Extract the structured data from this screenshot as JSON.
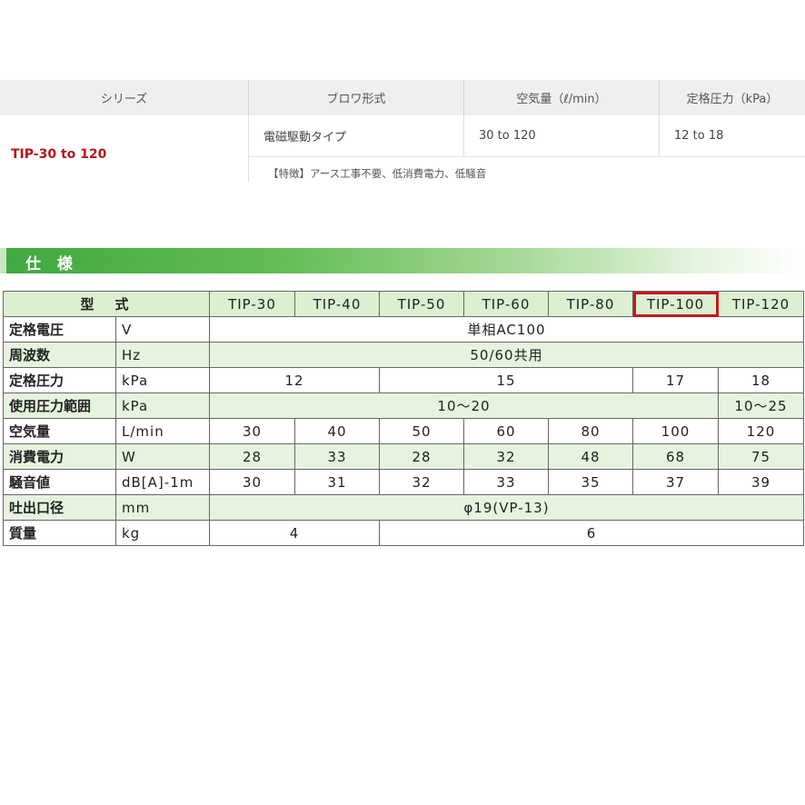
{
  "summary": {
    "headers": [
      "シリーズ",
      "ブロワ形式",
      "空気量（ℓ/min）",
      "定格圧力（kPa）"
    ],
    "series": "TIP-30 to 120",
    "type": "電磁駆動タイプ",
    "air_volume": "30 to 120",
    "pressure": "12 to 18",
    "features": "【特徴】アース工事不要、低消費電力、低騒音"
  },
  "section": {
    "title": "仕 様"
  },
  "spec": {
    "header_label": "型　式",
    "models": [
      "TIP-30",
      "TIP-40",
      "TIP-50",
      "TIP-60",
      "TIP-80",
      "TIP-100",
      "TIP-120"
    ],
    "highlighted_model": "TIP-100",
    "highlight_color": "#c8161d",
    "rows": [
      {
        "label": "定格電圧",
        "unit": "V",
        "cells": [
          {
            "text": "単相AC100",
            "span": 7
          }
        ]
      },
      {
        "label": "周波数",
        "unit": "Hz",
        "cells": [
          {
            "text": "50/60共用",
            "span": 7
          }
        ]
      },
      {
        "label": "定格圧力",
        "unit": "kPa",
        "cells": [
          {
            "text": "12",
            "span": 2
          },
          {
            "text": "15",
            "span": 3
          },
          {
            "text": "17",
            "span": 1
          },
          {
            "text": "18",
            "span": 1
          }
        ]
      },
      {
        "label": "使用圧力範囲",
        "unit": "kPa",
        "cells": [
          {
            "text": "10〜20",
            "span": 6
          },
          {
            "text": "10〜25",
            "span": 1
          }
        ]
      },
      {
        "label": "空気量",
        "unit": "L/min",
        "cells": [
          {
            "text": "30",
            "span": 1
          },
          {
            "text": "40",
            "span": 1
          },
          {
            "text": "50",
            "span": 1
          },
          {
            "text": "60",
            "span": 1
          },
          {
            "text": "80",
            "span": 1
          },
          {
            "text": "100",
            "span": 1
          },
          {
            "text": "120",
            "span": 1
          }
        ]
      },
      {
        "label": "消費電力",
        "unit": "W",
        "cells": [
          {
            "text": "28",
            "span": 1
          },
          {
            "text": "33",
            "span": 1
          },
          {
            "text": "28",
            "span": 1
          },
          {
            "text": "32",
            "span": 1
          },
          {
            "text": "48",
            "span": 1
          },
          {
            "text": "68",
            "span": 1
          },
          {
            "text": "75",
            "span": 1
          }
        ]
      },
      {
        "label": "騒音値",
        "unit": "dB[A]-1m",
        "cells": [
          {
            "text": "30",
            "span": 1
          },
          {
            "text": "31",
            "span": 1
          },
          {
            "text": "32",
            "span": 1
          },
          {
            "text": "33",
            "span": 1
          },
          {
            "text": "35",
            "span": 1
          },
          {
            "text": "37",
            "span": 1
          },
          {
            "text": "39",
            "span": 1
          }
        ]
      },
      {
        "label": "吐出口径",
        "unit": "mm",
        "cells": [
          {
            "text": "φ19(VP-13)",
            "span": 7
          }
        ]
      },
      {
        "label": "質量",
        "unit": "kg",
        "cells": [
          {
            "text": "4",
            "span": 2
          },
          {
            "text": "6",
            "span": 5
          }
        ]
      }
    ],
    "colors": {
      "row_shade": "#e6f3de",
      "header_shade": "#dcefd1",
      "heading_green": "#3fa93f"
    }
  }
}
